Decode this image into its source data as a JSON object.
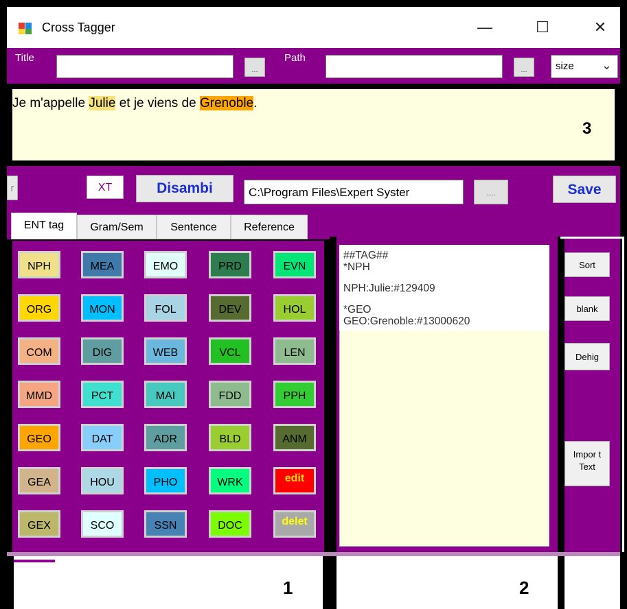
{
  "window": {
    "title": "Cross Tagger",
    "controls": {
      "minimize": "—",
      "maximize": "☐",
      "close": "✕"
    }
  },
  "toolbar": {
    "title_label": "Title",
    "title_value": "",
    "title_browse": "...",
    "path_label": "Path",
    "path_value": "",
    "path_browse": "...",
    "size_select": "size"
  },
  "editor": {
    "parts": [
      "Je m'appelle ",
      "Julie",
      " et je viens de ",
      "Grenoble",
      "."
    ],
    "zone_number": "3"
  },
  "actions": {
    "left_partial": "r",
    "xt_label": "XT",
    "disambi_label": "Disambi",
    "path_field": "C:\\Program Files\\Expert Syster",
    "path_browse": "....",
    "save_label": "Save"
  },
  "tabs": [
    "ENT tag",
    "Gram/Sem",
    "Sentence",
    "Reference"
  ],
  "tags": [
    [
      "NPH",
      "MEA",
      "EMO",
      "PRD",
      "EVN"
    ],
    [
      "ORG",
      "MON",
      "FOL",
      "DEV",
      "HOL"
    ],
    [
      "COM",
      "DIG",
      "WEB",
      "VCL",
      "LEN"
    ],
    [
      "MMD",
      "PCT",
      "MAI",
      "FDD",
      "PPH"
    ],
    [
      "GEO",
      "DAT",
      "ADR",
      "BLD",
      "ANM"
    ],
    [
      "GEA",
      "HOU",
      "PHO",
      "WRK",
      "edit"
    ],
    [
      "GEX",
      "SCO",
      "SSN",
      "DOC",
      "delet"
    ]
  ],
  "tag_colors": [
    [
      "#f0e08a",
      "#3f7aab",
      "#e0fffa",
      "#2e7d4f",
      "#00e676"
    ],
    [
      "#ffd700",
      "#00bfff",
      "#a8d4e6",
      "#556b2f",
      "#9acd32"
    ],
    [
      "#f4b183",
      "#5f9ea0",
      "#6bb7dd",
      "#22c022",
      "#8fbc8f"
    ],
    [
      "#f5a582",
      "#40e0d0",
      "#48c9c0",
      "#8fbc8f",
      "#32cd32"
    ],
    [
      "#ffa500",
      "#87cefa",
      "#5f9ea0",
      "#9acd32",
      "#556b2f"
    ],
    [
      "#d2b48c",
      "#add8e6",
      "#00bfff",
      "#00ff7f",
      "#ff0000"
    ],
    [
      "#bdb76b",
      "#e0ffff",
      "#4682b4",
      "#7cfc00",
      "#a9a9a9"
    ]
  ],
  "tag_text_colors": [
    [
      "#000",
      "#000",
      "#000",
      "#000",
      "#000"
    ],
    [
      "#000",
      "#000",
      "#000",
      "#000",
      "#000"
    ],
    [
      "#000",
      "#000",
      "#000",
      "#000",
      "#000"
    ],
    [
      "#000",
      "#000",
      "#000",
      "#000",
      "#000"
    ],
    [
      "#000",
      "#000",
      "#000",
      "#000",
      "#000"
    ],
    [
      "#000",
      "#000",
      "#000",
      "#000",
      "#ffd700"
    ],
    [
      "#000",
      "#000",
      "#000",
      "#000",
      "#ffff00"
    ]
  ],
  "output_lines": [
    "##TAG##",
    "*NPH",
    "NPH:Julie:#129409",
    "*GEO",
    "GEO:Grenoble:#13000620"
  ],
  "side_buttons": {
    "sort": "Sort",
    "blank": "blank",
    "dehig": "Dehig",
    "import": "Impor t Text"
  },
  "zone_numbers": {
    "panel1": "1",
    "panel2": "2"
  },
  "colors": {
    "purple": "#8b008b",
    "editor_bg": "#fefee0",
    "highlight_yellow": "#f5e27a",
    "highlight_orange": "#ffa500"
  }
}
